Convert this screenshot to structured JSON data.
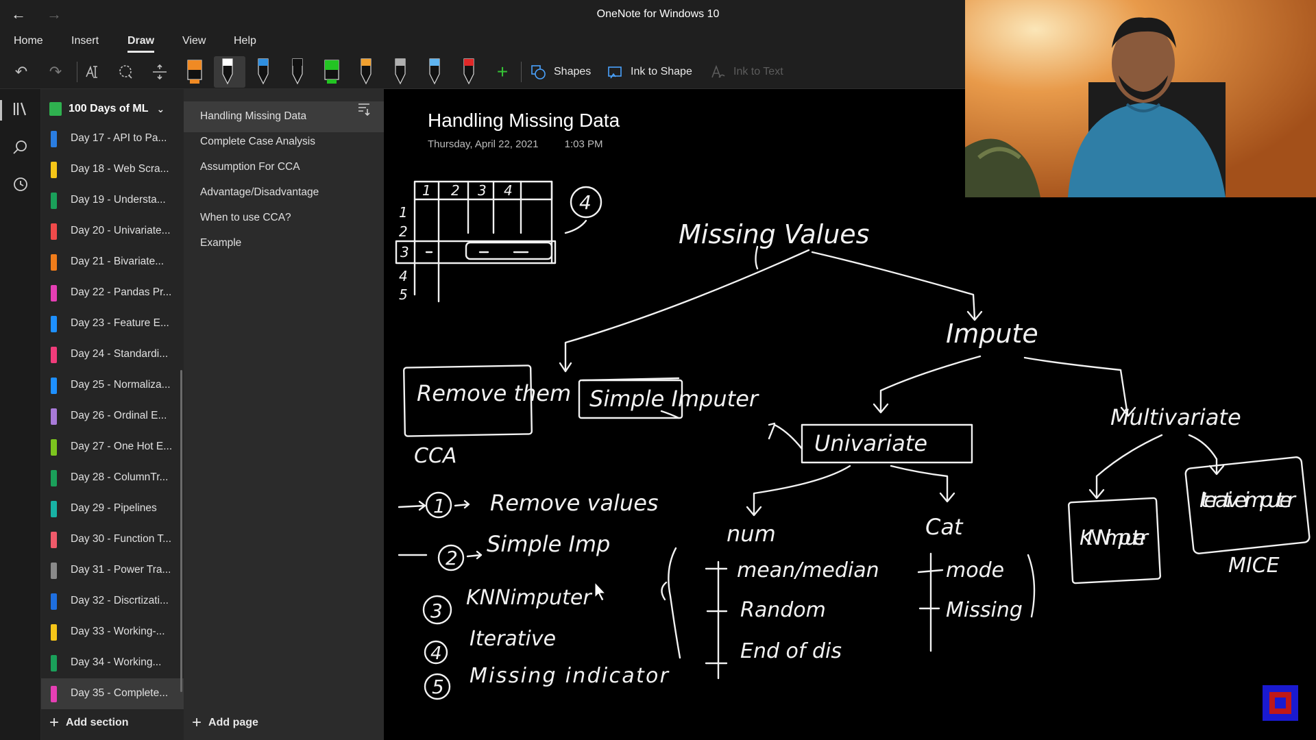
{
  "app": {
    "window_title": "OneNote for Windows 10"
  },
  "menu": {
    "tabs": [
      {
        "label": "Home"
      },
      {
        "label": "Insert"
      },
      {
        "label": "Draw"
      },
      {
        "label": "View"
      },
      {
        "label": "Help"
      }
    ],
    "active_tab": "Draw"
  },
  "toolbar": {
    "shapes_label": "Shapes",
    "ink_to_shape_label": "Ink to Shape",
    "ink_to_text_label": "Ink to Text",
    "pens": [
      {
        "name": "highlighter-orange",
        "color": "#f08a24"
      },
      {
        "name": "pen-white",
        "color": "#ffffff"
      },
      {
        "name": "pen-blue",
        "color": "#2f8fe0"
      },
      {
        "name": "pen-black",
        "color": "#111111"
      },
      {
        "name": "highlighter-green",
        "color": "#23c423"
      },
      {
        "name": "pen-orange",
        "color": "#f0a030"
      },
      {
        "name": "pen-gray",
        "color": "#b0b0b0"
      },
      {
        "name": "pen-lightblue",
        "color": "#5fb4f0"
      },
      {
        "name": "pen-red",
        "color": "#e02828"
      }
    ],
    "add_pen_color": "#35c435"
  },
  "notebook": {
    "name": "100 Days of ML",
    "add_section_label": "Add section",
    "sections": [
      {
        "label": "Day 17 - API to Pa...",
        "color": "#2a7de1"
      },
      {
        "label": "Day 18 - Web Scra...",
        "color": "#f5c518"
      },
      {
        "label": "Day 19 - Understa...",
        "color": "#1aa05a"
      },
      {
        "label": "Day 20 - Univariate...",
        "color": "#f04a4a"
      },
      {
        "label": "Day 21 - Bivariate...",
        "color": "#f07c1a"
      },
      {
        "label": "Day 22 - Pandas Pr...",
        "color": "#e63fb4"
      },
      {
        "label": "Day 23 - Feature E...",
        "color": "#1e90ff"
      },
      {
        "label": "Day 24 - Standardi...",
        "color": "#f03c7a"
      },
      {
        "label": "Day 25 - Normaliza...",
        "color": "#1e90ff"
      },
      {
        "label": "Day 26 - Ordinal E...",
        "color": "#a87ad8"
      },
      {
        "label": "Day 27 - One Hot E...",
        "color": "#7cc41e"
      },
      {
        "label": "Day 28 - ColumnTr...",
        "color": "#1aa05a"
      },
      {
        "label": "Day 29 - Pipelines",
        "color": "#18b2a5"
      },
      {
        "label": "Day 30 - Function T...",
        "color": "#f05a6a"
      },
      {
        "label": "Day 31 - Power Tra...",
        "color": "#8a8a8a"
      },
      {
        "label": "Day 32 - Discrtizati...",
        "color": "#1e6fe0"
      },
      {
        "label": "Day 33 - Working-...",
        "color": "#f5c518"
      },
      {
        "label": "Day 34 - Working...",
        "color": "#1aa05a"
      },
      {
        "label": "Day 35 - Complete...",
        "color": "#e63fb4"
      }
    ],
    "selected_section_index": 18
  },
  "pages": {
    "add_page_label": "Add page",
    "items": [
      {
        "label": "Handling Missing Data"
      },
      {
        "label": "Complete Case Analysis"
      },
      {
        "label": "Assumption For CCA"
      },
      {
        "label": "Advantage/Disadvantage"
      },
      {
        "label": "When to use CCA?"
      },
      {
        "label": "Example"
      }
    ],
    "selected_page_index": 0
  },
  "page": {
    "title": "Handling Missing Data",
    "date": "Thursday, April 22, 2021",
    "time": "1:03 PM"
  },
  "ink_notes": {
    "table_headers": [
      "1",
      "2",
      "3",
      "4"
    ],
    "row_numbers": [
      "1",
      "2",
      "3",
      "4",
      "5"
    ],
    "circled_count": "4",
    "root": "Missing Values",
    "remove_branch": "Remove them",
    "impute_branch": "Impute",
    "simple_impute": "Simple Imputer",
    "univariate": "Univariate",
    "multivariate": "Multivariate",
    "cca_note": "CCA",
    "num": "num",
    "num_items": [
      "mean/median",
      "Random",
      "End of dis"
    ],
    "cat": "Cat",
    "cat_items": [
      "mode",
      "Missing"
    ],
    "knn_box": "KNN imputer",
    "iterative_box": "Iterative imputer",
    "mice": "MICE",
    "numbered_list": [
      {
        "num": "1",
        "text": "Remove values"
      },
      {
        "num": "2",
        "text": "Simple Imp"
      },
      {
        "num": "3",
        "text": "KNNimputer"
      },
      {
        "num": "4",
        "text": "Iterative"
      },
      {
        "num": "5",
        "text": "Missing indicator"
      }
    ]
  }
}
